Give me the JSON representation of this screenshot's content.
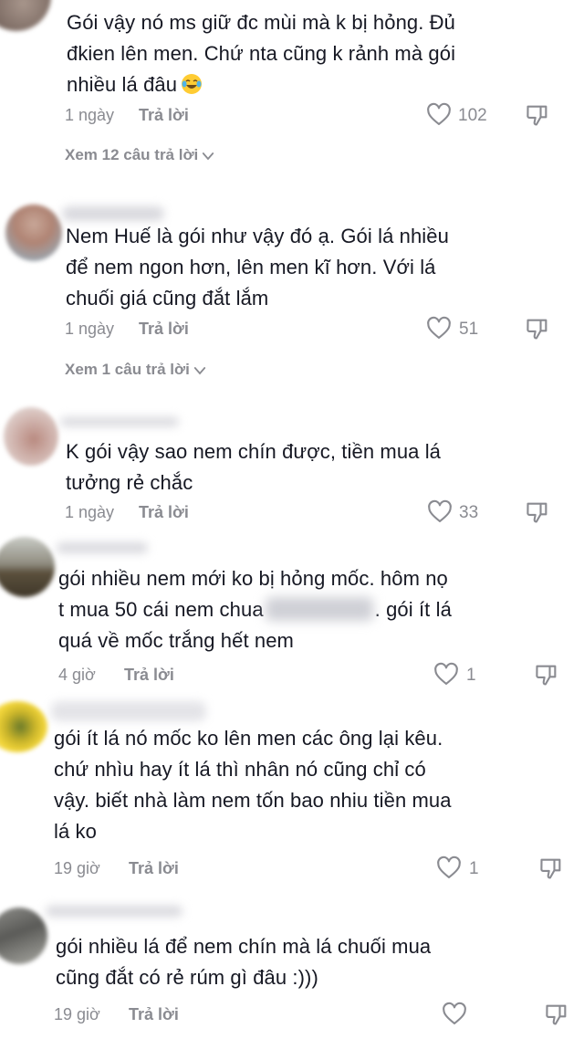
{
  "comments": [
    {
      "text_lines": [
        "Gói vậy nó ms giữ đc mùi mà k bị hỏng. Đủ",
        "đkien lên men. Chứ nta cũng k rảnh mà gói",
        "nhiều lá đâu"
      ],
      "emoji": "face-with-tears-of-joy",
      "time": "1 ngày",
      "reply_label": "Trả lời",
      "likes": "102",
      "view_replies": "Xem 12 câu trả lời"
    },
    {
      "text_lines": [
        "Nem Huế là gói như vậy đó ạ. Gói lá nhiều",
        "để nem ngon hơn, lên men kĩ hơn. Với lá",
        "chuối giá cũng đắt lắm"
      ],
      "time": "1 ngày",
      "reply_label": "Trả lời",
      "likes": "51",
      "view_replies": "Xem 1 câu trả lời"
    },
    {
      "text_lines": [
        "K gói vậy sao nem chín được, tiền mua lá",
        "tưởng rẻ chắc"
      ],
      "time": "1 ngày",
      "reply_label": "Trả lời",
      "likes": "33"
    },
    {
      "text_line_1": "gói nhiều nem mới ko bị hỏng mốc. hôm nọ",
      "text_line_2a": "t mua 50 cái nem chua",
      "text_line_2b": ". gói ít lá",
      "text_line_3": "quá về mốc trắng hết nem",
      "time": "4 giờ",
      "reply_label": "Trả lời",
      "likes": "1"
    },
    {
      "text_lines": [
        "gói ít lá nó mốc ko lên men các ông lại kêu.",
        "chứ nhìu hay ít lá thì nhân nó cũng chỉ có",
        "vậy. biết nhà làm nem tốn bao nhiu tiền mua",
        "lá ko"
      ],
      "time": "19 giờ",
      "reply_label": "Trả lời",
      "likes": "1"
    },
    {
      "text_lines": [
        "gói nhiều lá để nem chín mà lá chuối mua",
        "cũng đắt có rẻ rúm gì đâu :)))"
      ],
      "time": "19 giờ",
      "reply_label": "Trả lời",
      "likes": ""
    }
  ],
  "icons": {
    "like": "heart-outline-icon",
    "dislike": "thumbs-down-outline-icon",
    "expand": "chevron-down-icon"
  },
  "colors": {
    "text": "#161823",
    "meta": "#8a8b91"
  }
}
